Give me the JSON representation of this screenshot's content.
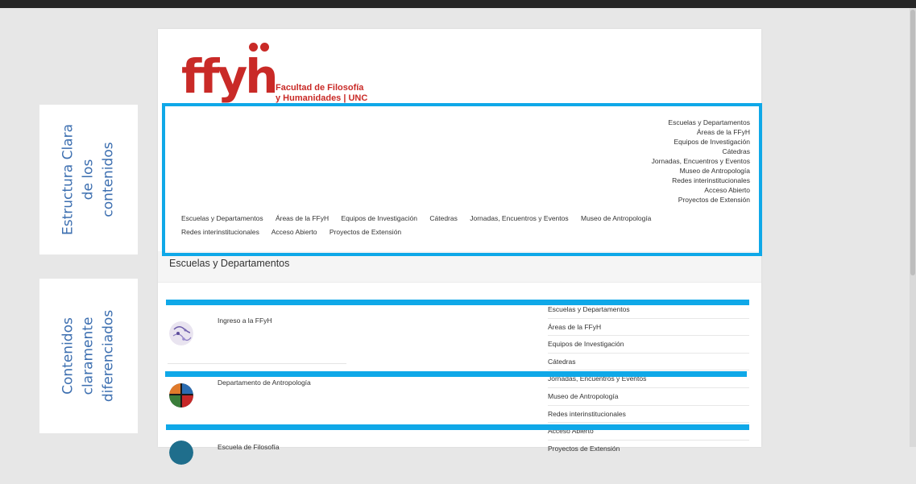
{
  "annotations": {
    "left_top": "Estructura Clara\nde los\ncontenidos",
    "left_bottom": "Contenidos\nclaramente\ndiferenciados"
  },
  "logo": {
    "mark": "ffyh",
    "line1": "Facultad de Filosofía",
    "line2": "y Humanidades | UNC"
  },
  "vertical_menu": [
    "Escuelas y Departamentos",
    "Áreas de la FFyH",
    "Equipos de Investigación",
    "Cátedras",
    "Jornadas, Encuentros y Eventos",
    "Museo de Antropología",
    "Redes interinstitucionales",
    "Acceso Abierto",
    "Proyectos de Extensión"
  ],
  "horizontal_menu": [
    "Escuelas y Departamentos",
    "Áreas de la FFyH",
    "Equipos de Investigación",
    "Cátedras",
    "Jornadas, Encuentros y Eventos",
    "Museo de Antropología",
    "Redes interinstitucionales",
    "Acceso Abierto",
    "Proyectos de Extensión"
  ],
  "section_title": "Escuelas y Departamentos",
  "cards": [
    {
      "title": "Ingreso a la FFyH"
    },
    {
      "title": "Departamento de Antropología"
    },
    {
      "title": "Escuela de Filosofía"
    }
  ],
  "side_list": [
    "Escuelas y Departamentos",
    "Áreas de la FFyH",
    "Equipos de Investigación",
    "Cátedras",
    "Jornadas, Encuentros y Eventos",
    "Museo de Antropología",
    "Redes interinstitucionales",
    "Acceso Abierto",
    "Proyectos de Extensión"
  ],
  "colors": {
    "accent_blue": "#0fa8e8",
    "brand_red": "#c92a27",
    "annotation_text": "#3d6fb0"
  }
}
